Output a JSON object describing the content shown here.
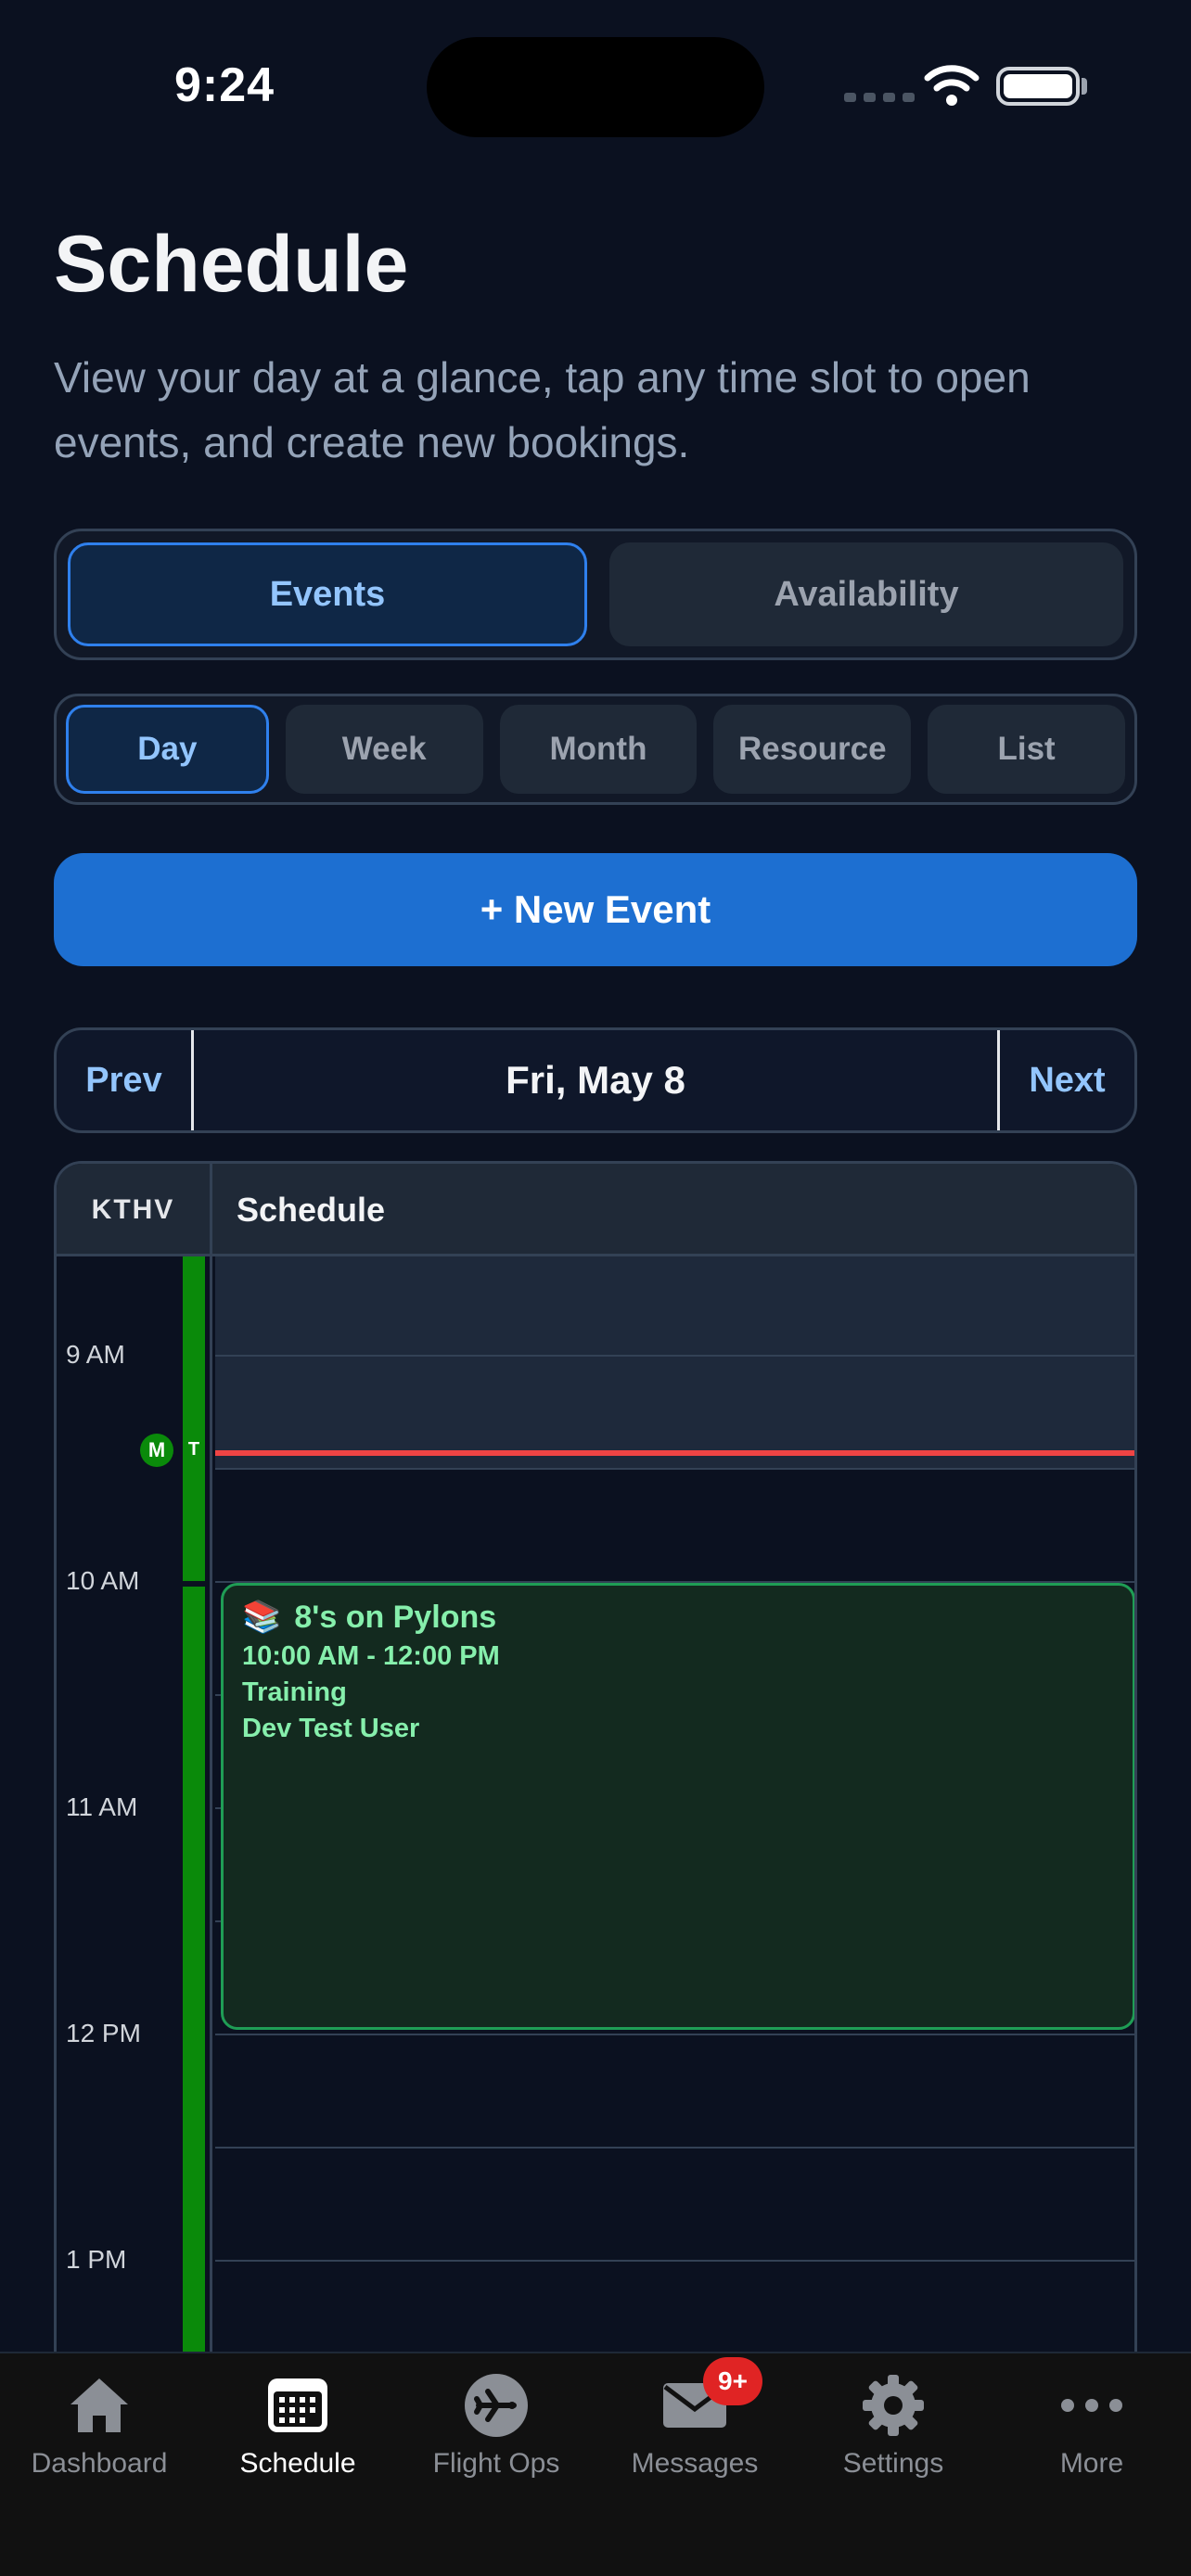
{
  "status_bar": {
    "time": "9:24"
  },
  "header": {
    "title": "Schedule",
    "subtitle": "View your day at a glance, tap any time slot to open events, and create new bookings."
  },
  "mode_tabs": [
    {
      "label": "Events",
      "active": true
    },
    {
      "label": "Availability",
      "active": false
    }
  ],
  "view_tabs": [
    {
      "label": "Day",
      "active": true
    },
    {
      "label": "Week",
      "active": false
    },
    {
      "label": "Month",
      "active": false
    },
    {
      "label": "Resource",
      "active": false
    },
    {
      "label": "List",
      "active": false
    }
  ],
  "new_event_label": "+ New Event",
  "date_nav": {
    "prev": "Prev",
    "date": "Fri, May 8",
    "next": "Next"
  },
  "calendar": {
    "resource_label": "KTHV",
    "column_title": "Schedule",
    "hours": [
      "9 AM",
      "10 AM",
      "11 AM",
      "12 PM",
      "1 PM"
    ],
    "availability_markers": {
      "m": "M",
      "t": "T"
    },
    "events": [
      {
        "emoji": "📚",
        "title": "8's on Pylons",
        "time": "10:00 AM - 12:00 PM",
        "type": "Training",
        "user": "Dev Test User"
      }
    ]
  },
  "tabbar": {
    "items": [
      {
        "label": "Dashboard",
        "icon": "home-icon",
        "active": false
      },
      {
        "label": "Schedule",
        "icon": "calendar-icon",
        "active": true
      },
      {
        "label": "Flight Ops",
        "icon": "plane-icon",
        "active": false
      },
      {
        "label": "Messages",
        "icon": "mail-icon",
        "active": false,
        "badge": "9+"
      },
      {
        "label": "Settings",
        "icon": "gear-icon",
        "active": false
      },
      {
        "label": "More",
        "icon": "more-icon",
        "active": false
      }
    ]
  },
  "colors": {
    "accent": "#1d6fd1",
    "available": "#0a8a0a",
    "now_line": "#ef4444",
    "event_bg": "#132a1f",
    "event_text": "#86efac"
  }
}
